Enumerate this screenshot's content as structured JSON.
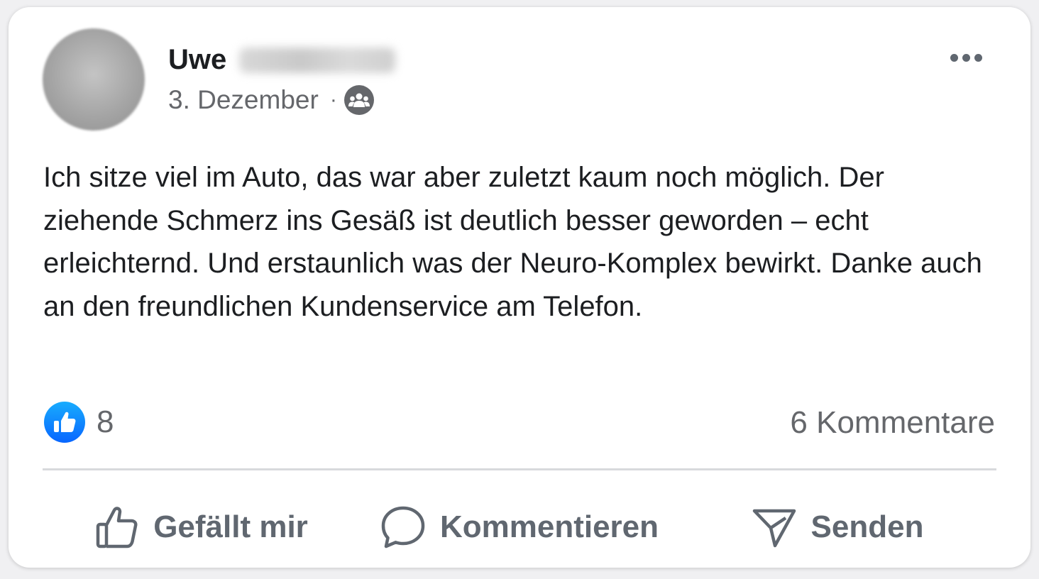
{
  "post": {
    "author_first_name": "Uwe",
    "date": "3. Dezember",
    "separator": "·",
    "audience_icon": "group-icon",
    "body": "Ich sitze viel im Auto, das war aber zuletzt kaum noch möglich. Der ziehende Schmerz ins Gesäß ist deutlich besser geworden – echt erleichternd. Und erstaunlich was der Neuro-Komplex bewirkt. Danke auch an den freundlichen Kundenservice am Telefon."
  },
  "reactions": {
    "like_count": "8",
    "comments_label": "6 Kommentare"
  },
  "actions": {
    "like_label": "Gefällt mir",
    "comment_label": "Kommentieren",
    "share_label": "Senden"
  },
  "colors": {
    "text_primary": "#1c1e21",
    "text_secondary": "#65676b",
    "like_blue": "#0866ff",
    "divider": "#d8d9dc"
  }
}
